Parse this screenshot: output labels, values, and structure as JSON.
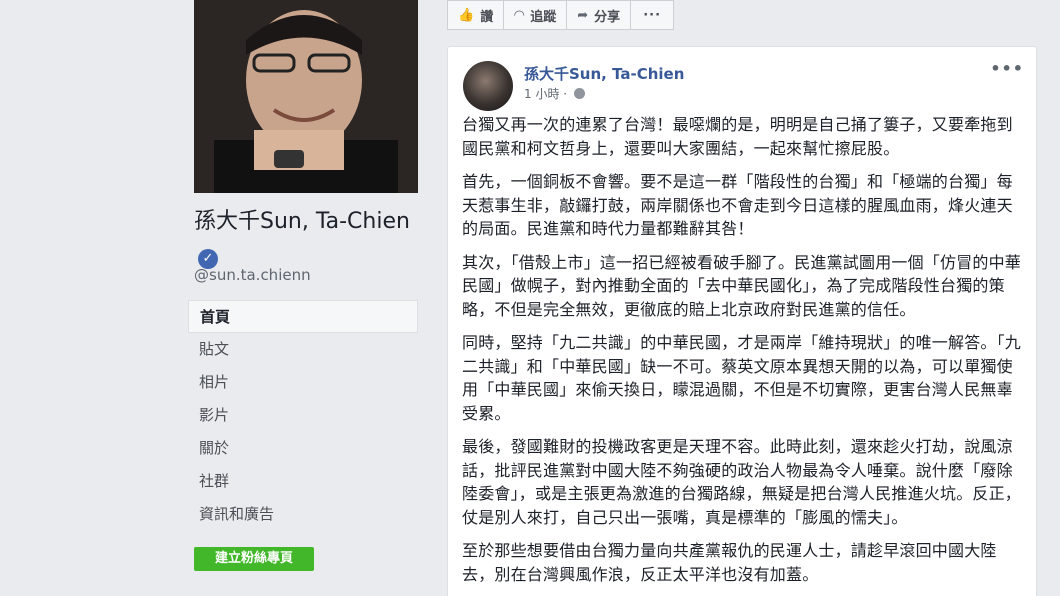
{
  "profile": {
    "name": "孫大千Sun, Ta-Chien",
    "handle": "@sun.ta.chienn"
  },
  "nav": {
    "items": [
      "首頁",
      "貼文",
      "相片",
      "影片",
      "關於",
      "社群",
      "資訊和廣告"
    ],
    "create_button": "建立粉絲專頁"
  },
  "actions": {
    "like": "讚",
    "follow": "追蹤",
    "share": "分享",
    "more": "···"
  },
  "post": {
    "author": "孫大千Sun, Ta-Chien",
    "time": "1 小時 · ",
    "more": "•••",
    "paragraphs": [
      "台獨又再一次的連累了台灣！最噁爛的是，明明是自己捅了簍子，又要牽拖到國民黨和柯文哲身上，還要叫大家團結，一起來幫忙擦屁股。",
      "首先，一個銅板不會響。要不是這一群「階段性的台獨」和「極端的台獨」每天惹事生非，敲鑼打鼓，兩岸關係也不會走到今日這樣的腥風血雨，烽火連天的局面。民進黨和時代力量都難辭其咎！",
      "其次，「借殼上市」這一招已經被看破手腳了。民進黨試圖用一個「仿冒的中華民國」做幌子，對內推動全面的「去中華民國化」，為了完成階段性台獨的策略，不但是完全無效，更徹底的賠上北京政府對民進黨的信任。",
      "同時，堅持「九二共識」的中華民國，才是兩岸「維持現狀」的唯一解答。「九二共識」和「中華民國」缺一不可。蔡英文原本異想天開的以為，可以單獨使用「中華民國」來偷天換日，矇混過關，不但是不切實際，更害台灣人民無辜受累。",
      "最後，發國難財的投機政客更是天理不容。此時此刻，還來趁火打劫，說風涼話，批評民進黨對中國大陸不夠強硬的政治人物最為令人唾棄。說什麼「廢除陸委會」，或是主張更為激進的台獨路線，無疑是把台灣人民推進火坑。反正，仗是別人來打，自己只出一張嘴，真是標準的「膨風的懦夫」。",
      "至於那些想要借由台獨力量向共產黨報仇的民運人士，請趁早滾回中國大陸去，別在台灣興風作浪，反正太平洋也沒有加蓋。"
    ]
  }
}
